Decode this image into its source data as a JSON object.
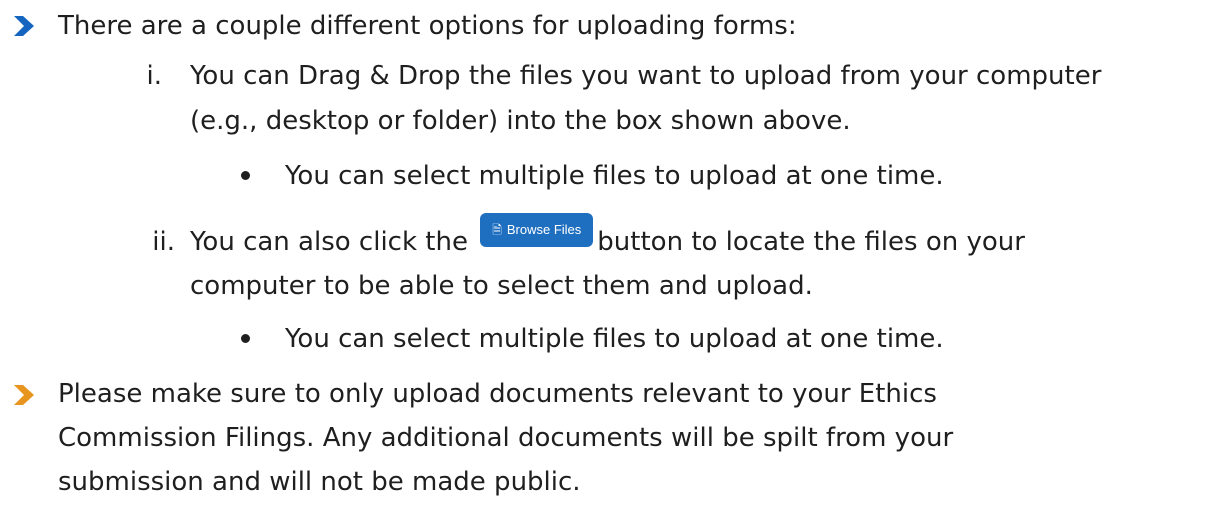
{
  "colors": {
    "arrow_blue": "#1565c0",
    "arrow_orange": "#e8951f",
    "button_blue": "#1f6fc0",
    "text": "#1f1f1f"
  },
  "bullets": [
    {
      "icon": "chevron-right-icon",
      "text": "There are a couple different options for uploading forms:"
    },
    {
      "icon": "chevron-right-icon",
      "lines": [
        "Please make sure to only upload documents relevant to your Ethics",
        "Commission Filings.  Any additional documents will be spilt from your",
        "submission and will not be made public."
      ]
    }
  ],
  "items": [
    {
      "marker": "i.",
      "lines": [
        "You can Drag & Drop the files you want to upload from your computer",
        "(e.g., desktop or folder) into the box shown above."
      ],
      "sub": "You can select multiple files to upload at one time."
    },
    {
      "marker": "ii.",
      "line1_before": "You can also click the",
      "line1_after": "button to locate the files on your",
      "line2": "computer to be able to select them and upload.",
      "sub": "You can select multiple files to upload at one time."
    }
  ],
  "browse_button": {
    "icon": "document-icon",
    "label": "Browse Files"
  }
}
